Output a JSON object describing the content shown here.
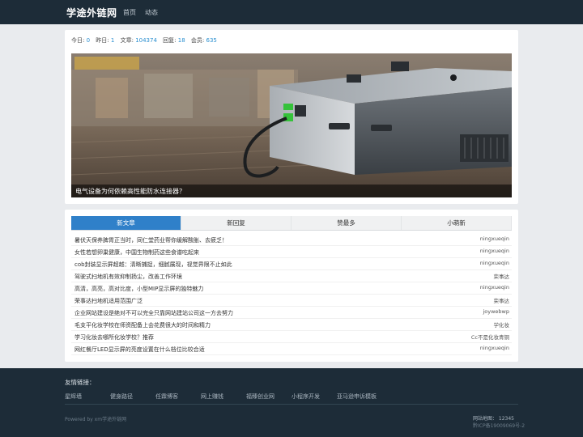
{
  "header": {
    "logo": "学途外链网",
    "nav": [
      "首页",
      "动态"
    ]
  },
  "stats": [
    {
      "label": "今日:",
      "value": "0"
    },
    {
      "label": "昨日:",
      "value": "1"
    },
    {
      "label": "文章:",
      "value": "104374"
    },
    {
      "label": "回复:",
      "value": "18"
    },
    {
      "label": "会员:",
      "value": "635"
    }
  ],
  "banner": {
    "caption": "电气设备为何依赖高性能防水连接器？"
  },
  "tabs": [
    "新文章",
    "新回复",
    "赞最多",
    "小萌新"
  ],
  "active_tab": "新文章",
  "articles": [
    {
      "title": "暑伏天保养脾胃正当时，同仁堂药业帮你缓解酸胀、去疲乏！",
      "author": "ningxueqin"
    },
    {
      "title": "女性若想卵巢健康，中国生物制药这些食谱吃起来",
      "author": "ningxueqin"
    },
    {
      "title": "cob封装显示屏超越：清晰捕捉，细腻展现，视觉界限不止如此",
      "author": "ningxueqin"
    },
    {
      "title": "驾驶式扫地机有效抑制扬尘，改善工作环境",
      "author": "荣事达"
    },
    {
      "title": "高清，高亮，高对比度，小型MIP显示屏的独特魅力",
      "author": "ningxueqin"
    },
    {
      "title": "荣事达扫地机适用范围广泛",
      "author": "荣事达"
    },
    {
      "title": "企业网站建设是绝对不可以完全只靠网站建站公司这一方去努力",
      "author": "joywebwp"
    },
    {
      "title": "毛支平化妆学校在师资配备上会花费很大的时间和精力",
      "author": "学化妆"
    },
    {
      "title": "学习化妆去哪所化妆学校？推荐",
      "author": "Cc不是化妆青铜"
    },
    {
      "title": "网红餐厅LED显示屏的亮度设置在什么档位比较合适",
      "author": "ningxueqin"
    }
  ],
  "footer": {
    "friends_label": "友情链接：",
    "links": [
      "星辉墙",
      "健身路径",
      "任霖博客",
      "网上赚钱",
      "福臻创业网",
      "小程序开发",
      "亚马逊申诉模板"
    ],
    "powered": "Powered by xm学途外链网",
    "sitemap": "网站地图：  12345",
    "icp": "黔ICP备19009069号-2"
  }
}
